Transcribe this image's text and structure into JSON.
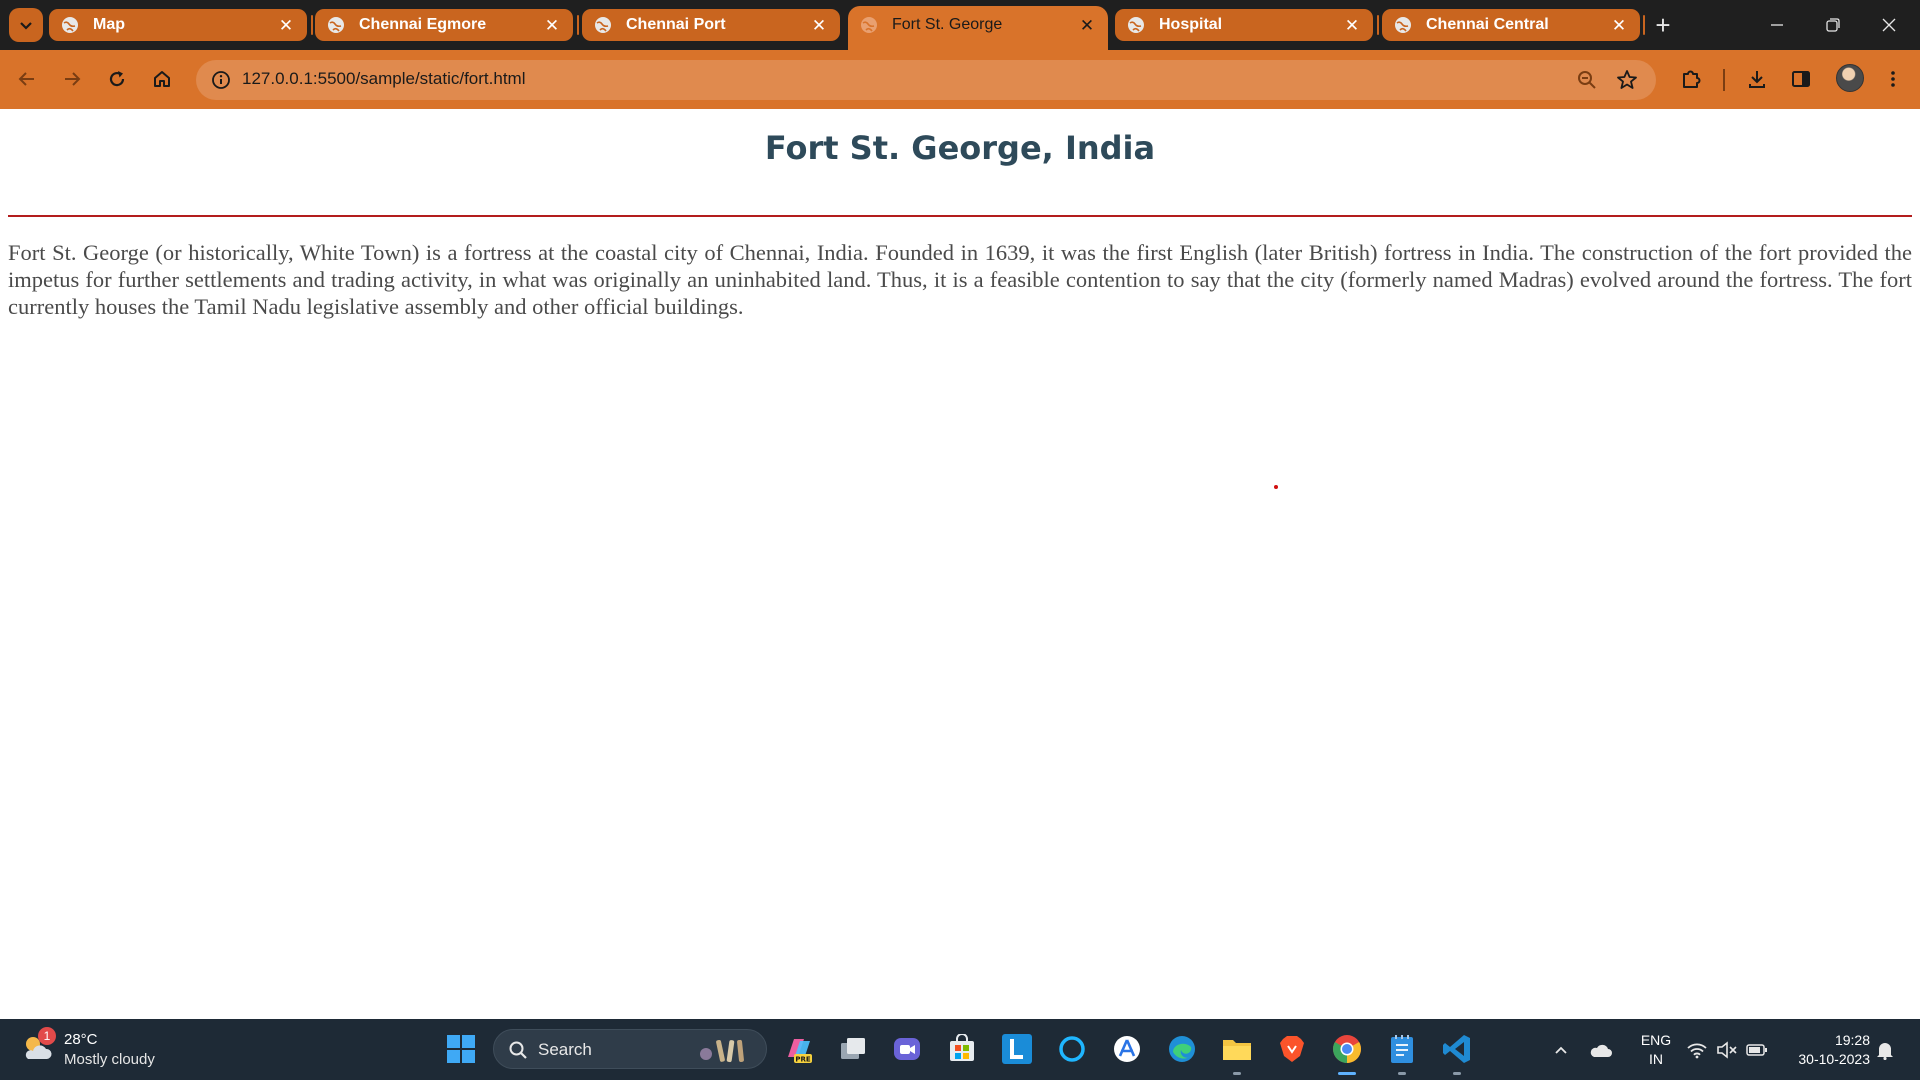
{
  "browser": {
    "tabs": [
      {
        "title": "Map",
        "active": false
      },
      {
        "title": "Chennai Egmore",
        "active": false
      },
      {
        "title": "Chennai Port",
        "active": false
      },
      {
        "title": "Fort St. George",
        "active": true
      },
      {
        "title": "Hospital",
        "active": false
      },
      {
        "title": "Chennai Central",
        "active": false
      }
    ],
    "close_glyph": "✕",
    "new_tab_glyph": "+",
    "address": "127.0.0.1:5500/sample/static/fort.html",
    "colors": {
      "tab_strip": "#1f1f1f",
      "tab": "#c9651f",
      "active_tab": "#d9732a",
      "toolbar": "#d9732a",
      "omnibox": "#e08a4e"
    }
  },
  "page": {
    "title": "Fort St. George, India",
    "body": "Fort St. George (or historically, White Town) is a fortress at the coastal city of Chennai, India. Founded in 1639, it was the first English (later British) fortress in India. The construction of the fort provided the impetus for further settlements and trading activity, in what was originally an uninhabited land. Thus, it is a feasible contention to say that the city (formerly named Madras) evolved around the fortress. The fort currently houses the Tamil Nadu legislative assembly and other official buildings.",
    "colors": {
      "title": "#2e4a5a",
      "rule": "#b31d1d",
      "body": "#4a4a4a",
      "dot": "#d01010"
    }
  },
  "taskbar": {
    "weather": {
      "badge": "1",
      "temp": "28°C",
      "desc": "Mostly cloudy"
    },
    "search_label": "Search",
    "apps": [
      "start-icon",
      "copilot-pre-icon",
      "task-view-icon",
      "teams-meet-icon",
      "microsoft-store-icon",
      "l-app-icon",
      "cortana-icon",
      "app-store-icon",
      "edge-icon",
      "file-explorer-icon",
      "brave-icon",
      "chrome-icon",
      "notepad-icon",
      "vscode-icon"
    ],
    "language": {
      "line1": "ENG",
      "line2": "IN"
    },
    "clock": {
      "time": "19:28",
      "date": "30-10-2023"
    }
  }
}
